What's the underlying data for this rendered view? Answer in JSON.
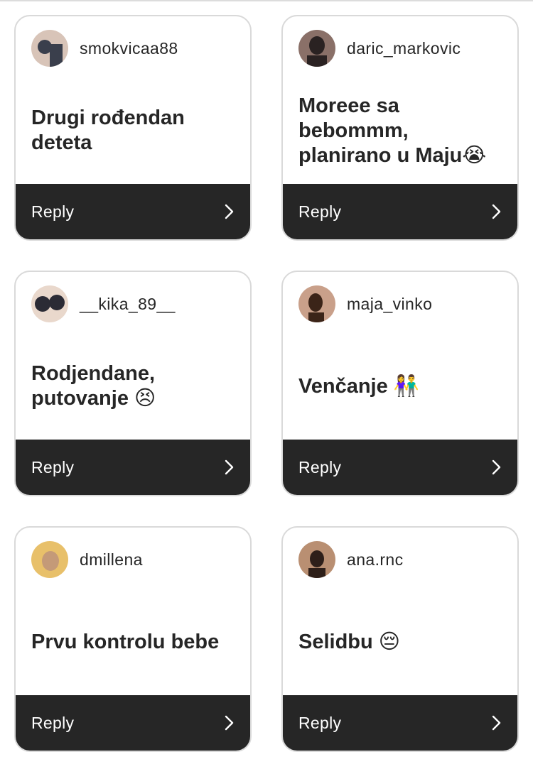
{
  "cards": [
    {
      "username": "smokvicaa88",
      "answer": "Drugi rođendan\ndeteta",
      "reply_label": "Reply",
      "avatar_colors": [
        "#d8c4b8",
        "#3a3f4c"
      ]
    },
    {
      "username": "daric_markovic",
      "answer": "Moreee sa\nbebommm,\nplanirano u Maju😭",
      "reply_label": "Reply",
      "avatar_colors": [
        "#8a7068",
        "#2a2222"
      ]
    },
    {
      "username": "__kika_89__",
      "answer": "Rodjendane,\nputovanje 😣",
      "reply_label": "Reply",
      "avatar_colors": [
        "#e9d8cc",
        "#2b2b35"
      ]
    },
    {
      "username": "maja_vinko",
      "answer": "Venčanje 👫",
      "reply_label": "Reply",
      "avatar_colors": [
        "#c9a08a",
        "#3b2418"
      ]
    },
    {
      "username": "dmillena",
      "answer": "Prvu kontrolu bebe",
      "reply_label": "Reply",
      "avatar_colors": [
        "#e8c06a",
        "#c49a78"
      ]
    },
    {
      "username": "ana.rnc",
      "answer": "Selidbu 😔",
      "reply_label": "Reply",
      "avatar_colors": [
        "#b98f72",
        "#2e1f19"
      ]
    }
  ]
}
